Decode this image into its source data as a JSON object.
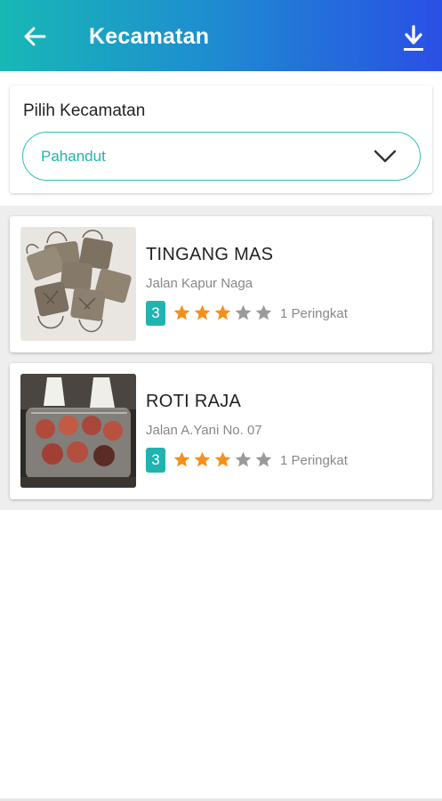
{
  "appbar": {
    "title": "Kecamatan",
    "back_icon": "arrow-left-icon",
    "download_icon": "download-icon"
  },
  "filter": {
    "label": "Pilih Kecamatan",
    "selected": "Pahandut",
    "chevron_icon": "chevron-down-icon"
  },
  "colors": {
    "accent": "#21b3b0",
    "gradient_start": "#17b8b6",
    "gradient_end": "#2a4fe6",
    "star_filled": "#f5901e",
    "star_empty": "#9a9a9a"
  },
  "stores": [
    {
      "name": "TINGANG MAS",
      "address": "Jalan Kapur Naga",
      "rating_value": "3",
      "stars_filled": 3,
      "stars_total": 5,
      "rating_count": "1 Peringkat",
      "image": "woven-bags-photo"
    },
    {
      "name": "ROTI RAJA",
      "address": "Jalan A.Yani No. 07",
      "rating_value": "3",
      "stars_filled": 3,
      "stars_total": 5,
      "rating_count": "1 Peringkat",
      "image": "bread-pastries-photo"
    }
  ]
}
